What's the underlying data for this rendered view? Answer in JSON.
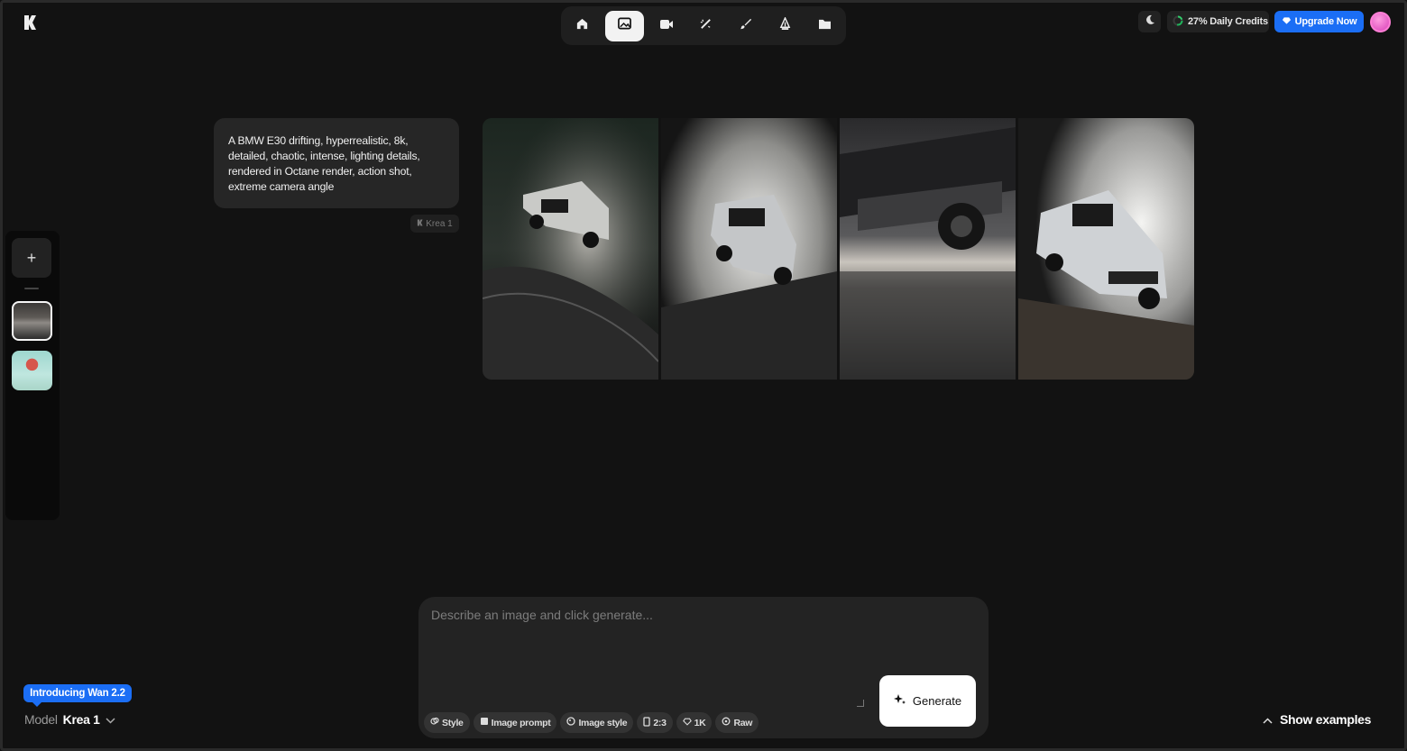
{
  "header": {
    "logo_icon": "krea-logo-icon",
    "toolbar": [
      {
        "name": "home",
        "icon": "home-icon",
        "active": false
      },
      {
        "name": "image",
        "icon": "image-icon",
        "active": true
      },
      {
        "name": "video",
        "icon": "video-icon",
        "active": false
      },
      {
        "name": "enhance",
        "icon": "wand-icon",
        "active": false
      },
      {
        "name": "edit",
        "icon": "brush-icon",
        "active": false
      },
      {
        "name": "train",
        "icon": "pen-tool-icon",
        "active": false
      },
      {
        "name": "assets",
        "icon": "folder-icon",
        "active": false
      }
    ],
    "credits_label": "27% Daily Credits",
    "upgrade_label": "Upgrade Now"
  },
  "conversation": {
    "prompt": "A BMW E30 drifting, hyperrealistic, 8k, detailed, chaotic, intense, lighting details, rendered in Octane render, action shot, extreme camera angle",
    "model_tag": "Krea 1",
    "images": [
      "bmw-drift-1",
      "bmw-drift-2",
      "bmw-underbody-3",
      "bmw-drift-4"
    ]
  },
  "composer": {
    "placeholder": "Describe an image and click generate...",
    "generate_label": "Generate",
    "chips": {
      "style": "Style",
      "image_prompt": "Image prompt",
      "image_style": "Image style",
      "aspect": "2:3",
      "resolution": "1K",
      "raw": "Raw"
    }
  },
  "footer": {
    "intro_label": "Introducing Wan 2.2",
    "model_label": "Model",
    "model_value": "Krea 1",
    "show_examples_label": "Show examples"
  },
  "colors": {
    "background": "#121212",
    "accent": "#1b6ef5",
    "panel": "#232323"
  }
}
